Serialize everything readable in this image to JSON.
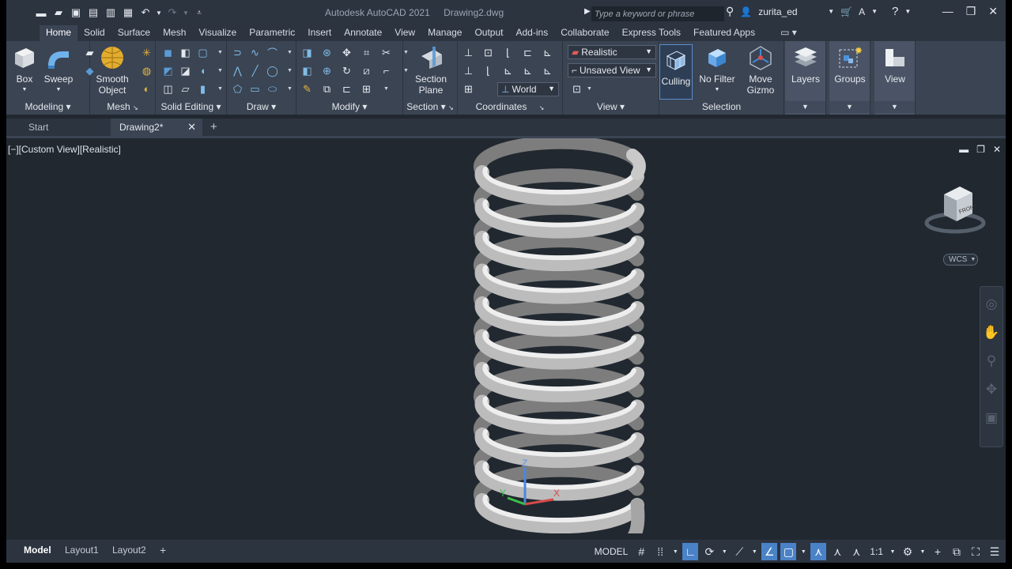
{
  "window": {
    "app_title": "Autodesk AutoCAD 2021",
    "file_title": "Drawing2.dwg",
    "search_placeholder": "Type a keyword or phrase",
    "user": "zurita_ed"
  },
  "quick_access": [
    "new-icon",
    "open-icon",
    "save-icon",
    "save-as-icon",
    "publish-icon",
    "print-icon",
    "undo-icon",
    "redo-icon",
    "customize-icon"
  ],
  "ribbon_tabs": [
    "Home",
    "Solid",
    "Surface",
    "Mesh",
    "Visualize",
    "Parametric",
    "Insert",
    "Annotate",
    "View",
    "Manage",
    "Output",
    "Add-ins",
    "Collaborate",
    "Express Tools",
    "Featured Apps"
  ],
  "active_tab": "Home",
  "ribbon": {
    "modeling": {
      "title": "Modeling",
      "box": "Box",
      "sweep": "Sweep"
    },
    "mesh": {
      "title": "Mesh",
      "smooth_line1": "Smooth",
      "smooth_line2": "Object"
    },
    "solid_editing": {
      "title": "Solid Editing"
    },
    "draw": {
      "title": "Draw"
    },
    "modify": {
      "title": "Modify"
    },
    "section": {
      "title": "Section",
      "plane_line1": "Section",
      "plane_line2": "Plane"
    },
    "coordinates": {
      "title": "Coordinates",
      "ucs_value": "World"
    },
    "view": {
      "title": "View",
      "visual_style": "Realistic",
      "named_view": "Unsaved View"
    },
    "selection": {
      "title": "Selection",
      "culling": "Culling",
      "no_filter": "No Filter",
      "move_line1": "Move",
      "move_line2": "Gizmo"
    },
    "layers": "Layers",
    "groups": "Groups",
    "view_btn": "View"
  },
  "doc_tabs": {
    "start": "Start",
    "current": "Drawing2*"
  },
  "viewport": {
    "label": "[−][Custom View][Realistic]",
    "wcs": "WCS",
    "viewcube_face": "FRONT",
    "axis_z": "Z",
    "axis_y": "Y",
    "axis_x": "X"
  },
  "layout_tabs": [
    "Model",
    "Layout1",
    "Layout2"
  ],
  "status": {
    "model": "MODEL",
    "scale": "1:1"
  }
}
